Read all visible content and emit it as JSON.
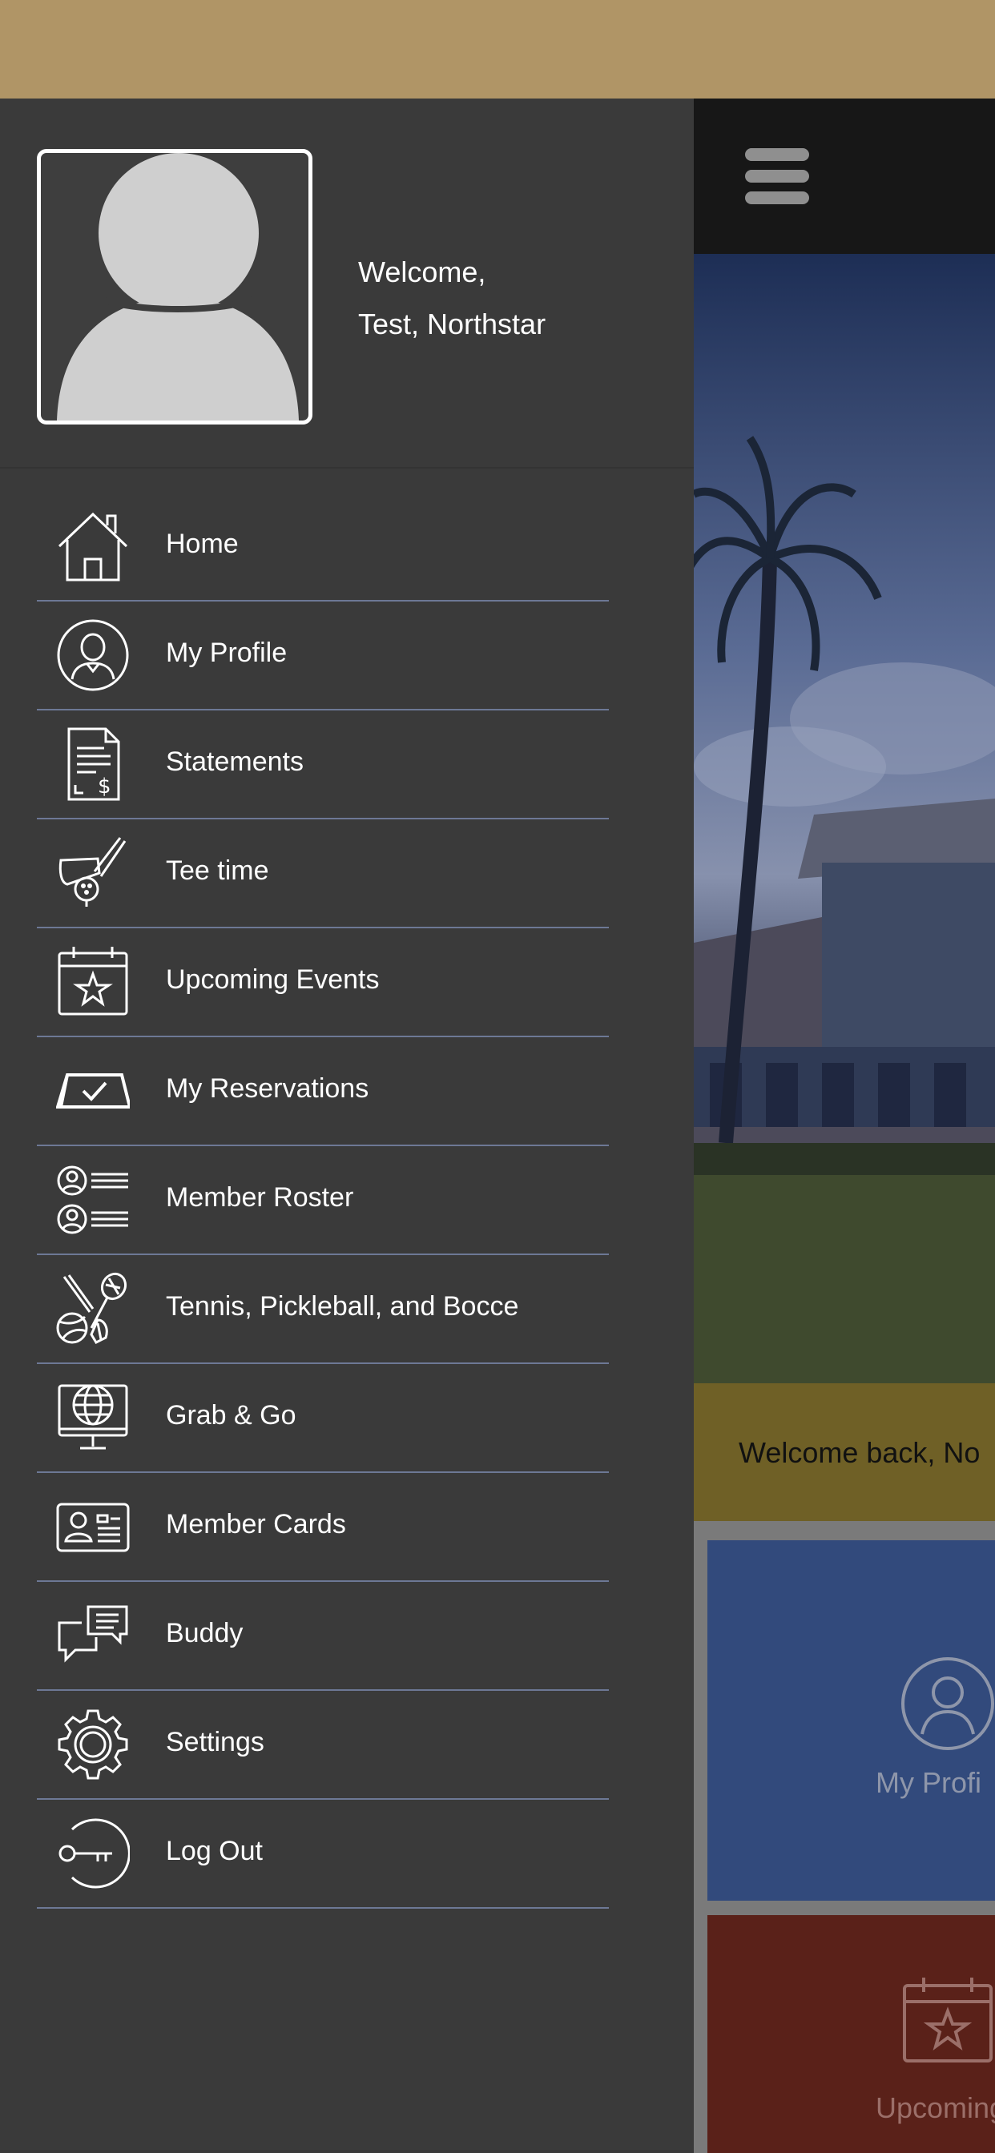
{
  "drawer": {
    "welcome_line1": "Welcome,",
    "welcome_line2": "Test, Northstar",
    "menu": [
      {
        "label": "Home",
        "icon": "home-icon"
      },
      {
        "label": "My Profile",
        "icon": "profile-icon"
      },
      {
        "label": "Statements",
        "icon": "statement-icon"
      },
      {
        "label": "Tee time",
        "icon": "golf-icon"
      },
      {
        "label": "Upcoming Events",
        "icon": "calendar-star-icon"
      },
      {
        "label": "My Reservations",
        "icon": "reservation-check-icon"
      },
      {
        "label": "Member Roster",
        "icon": "roster-icon"
      },
      {
        "label": "Tennis, Pickleball, and Bocce",
        "icon": "racquet-sports-icon"
      },
      {
        "label": "Grab & Go",
        "icon": "globe-monitor-icon"
      },
      {
        "label": "Member Cards",
        "icon": "id-card-icon"
      },
      {
        "label": "Buddy",
        "icon": "chat-icon"
      },
      {
        "label": "Settings",
        "icon": "gear-icon"
      },
      {
        "label": "Log Out",
        "icon": "key-icon"
      }
    ]
  },
  "app": {
    "welcome_text": "Welcome back, No",
    "tiles": [
      {
        "label": "My Profi",
        "color": "#324a7c"
      },
      {
        "label": "Upcoming E",
        "color": "#5a2119"
      }
    ]
  },
  "colors": {
    "status_bar": "#b09566",
    "drawer_bg": "#3a3a3a",
    "divider": "#6d7895",
    "text": "#ffffff"
  }
}
